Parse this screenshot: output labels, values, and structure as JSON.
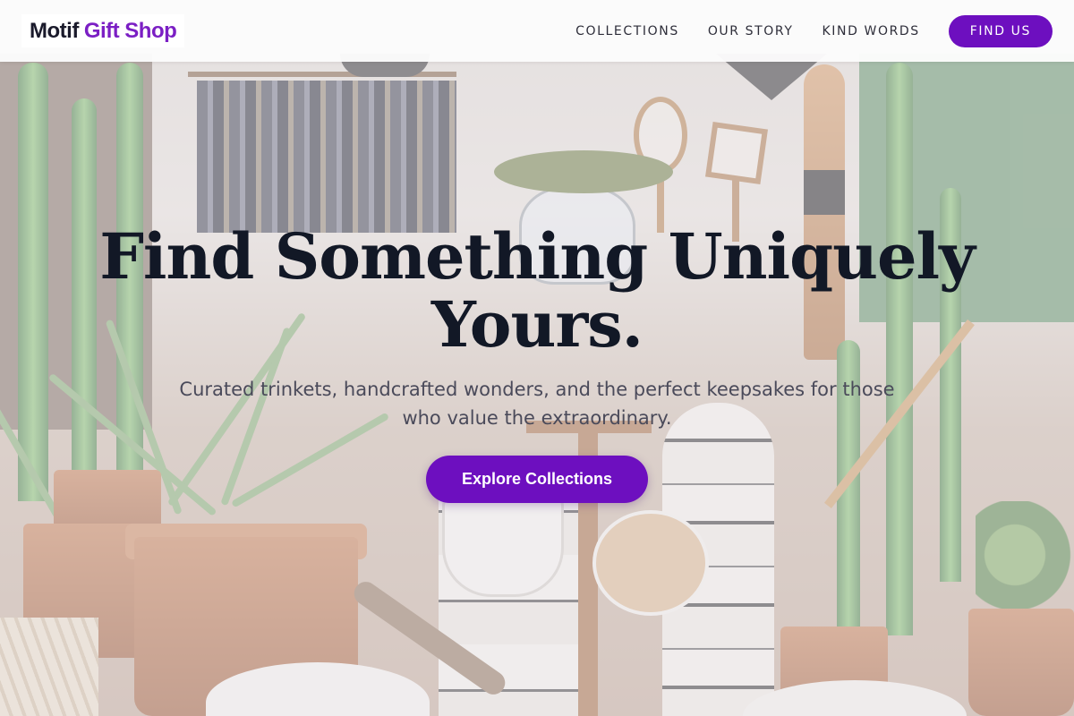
{
  "header": {
    "logo": {
      "main": "Motif",
      "accent": "Gift Shop"
    },
    "nav": [
      {
        "label": "COLLECTIONS"
      },
      {
        "label": "OUR STORY"
      },
      {
        "label": "KIND WORDS"
      }
    ],
    "cta_label": "FIND US"
  },
  "hero": {
    "title": "Find Something Uniquely Yours.",
    "subtitle": "Curated trinkets, handcrafted wonders, and the perfect keepsakes for those who value the extraordinary.",
    "cta_label": "Explore Collections"
  },
  "colors": {
    "accent": "#6d0fbf",
    "logo_accent": "#7b1fc4",
    "title": "#121826",
    "header_bg": "#fcfcfc"
  }
}
